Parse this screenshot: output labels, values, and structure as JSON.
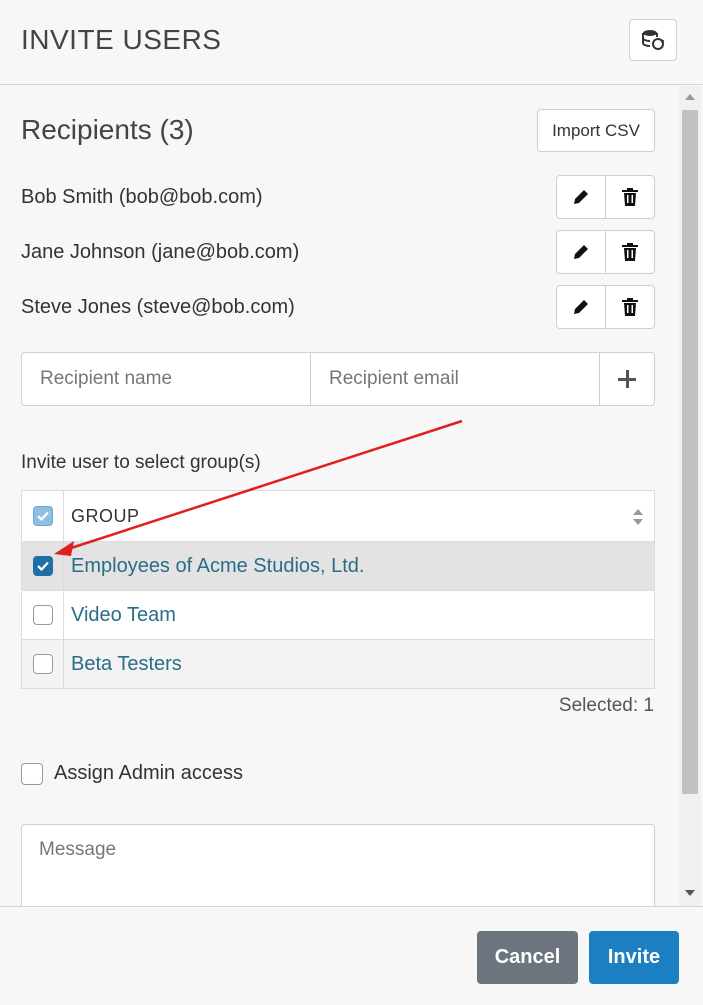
{
  "header": {
    "title": "INVITE USERS",
    "refresh_icon": "database-refresh-icon"
  },
  "recipients": {
    "title": "Recipients (3)",
    "import_label": "Import CSV",
    "list": [
      {
        "label": "Bob Smith (bob@bob.com)"
      },
      {
        "label": "Jane Johnson (jane@bob.com)"
      },
      {
        "label": "Steve Jones (steve@bob.com)"
      }
    ],
    "name_placeholder": "Recipient name",
    "email_placeholder": "Recipient email"
  },
  "groups": {
    "label": "Invite user to select group(s)",
    "column_header": "GROUP",
    "rows": [
      {
        "name": "Employees of Acme Studios, Ltd.",
        "checked": true
      },
      {
        "name": "Video Team",
        "checked": false
      },
      {
        "name": "Beta Testers",
        "checked": false
      }
    ],
    "selected_text": "Selected: 1"
  },
  "admin": {
    "label": "Assign Admin access",
    "checked": false
  },
  "message": {
    "placeholder": "Message"
  },
  "footer": {
    "cancel_label": "Cancel",
    "invite_label": "Invite"
  },
  "colors": {
    "primary": "#1b7fc1",
    "secondary": "#6c757d",
    "link": "#2a6d86",
    "annotation": "#e02020"
  }
}
